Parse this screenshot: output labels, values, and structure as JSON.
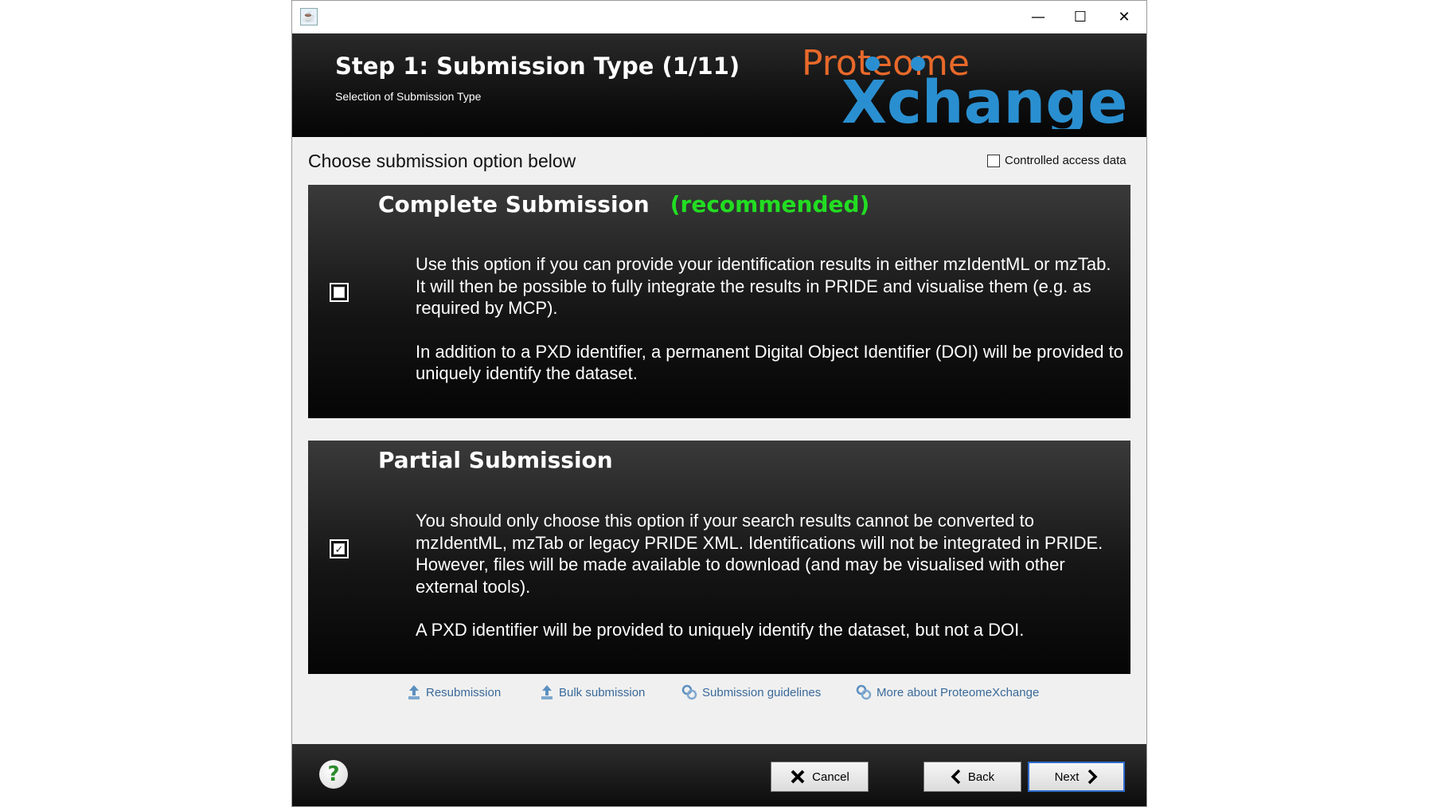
{
  "window": {
    "app_icon": "java-app-icon",
    "controls": [
      "minimize-icon",
      "maximize-icon",
      "close-icon"
    ]
  },
  "header": {
    "title": "Step 1: Submission Type (1/11)",
    "subtitle": "Selection of Submission Type",
    "logo_text_top": "Proteome",
    "logo_text_bottom": "Xchange",
    "logo_colors": {
      "proteome": "#e8692a",
      "xchange": "#2a8fd0"
    }
  },
  "main": {
    "choose_label": "Choose submission option below",
    "controlled_access": {
      "label": "Controlled access data",
      "checked": false
    }
  },
  "options": [
    {
      "title": "Complete Submission",
      "badge": "(recommended)",
      "checked": false,
      "paragraphs": [
        "Use this option if you can provide your identification results in either mzIdentML or mzTab. It will then be possible to fully integrate the results in PRIDE and visualise them (e.g. as required by MCP).",
        "In addition to a PXD identifier, a permanent Digital Object Identifier (DOI) will be provided to uniquely identify the dataset."
      ]
    },
    {
      "title": "Partial Submission",
      "badge": "",
      "checked": true,
      "paragraphs": [
        "You should only choose this option if your search results cannot be converted to mzIdentML, mzTab or legacy PRIDE XML. Identifications will not be integrated in PRIDE. However, files will be made available to download (and may be visualised with other external tools).",
        "A PXD identifier will be provided to uniquely identify the dataset, but not a DOI."
      ]
    }
  ],
  "links": {
    "resubmission": "Resubmission",
    "bulk": "Bulk submission",
    "guidelines": "Submission guidelines",
    "more": "More about ProteomeXchange"
  },
  "footer": {
    "help": "?",
    "cancel": "Cancel",
    "back": "Back",
    "next": "Next"
  }
}
